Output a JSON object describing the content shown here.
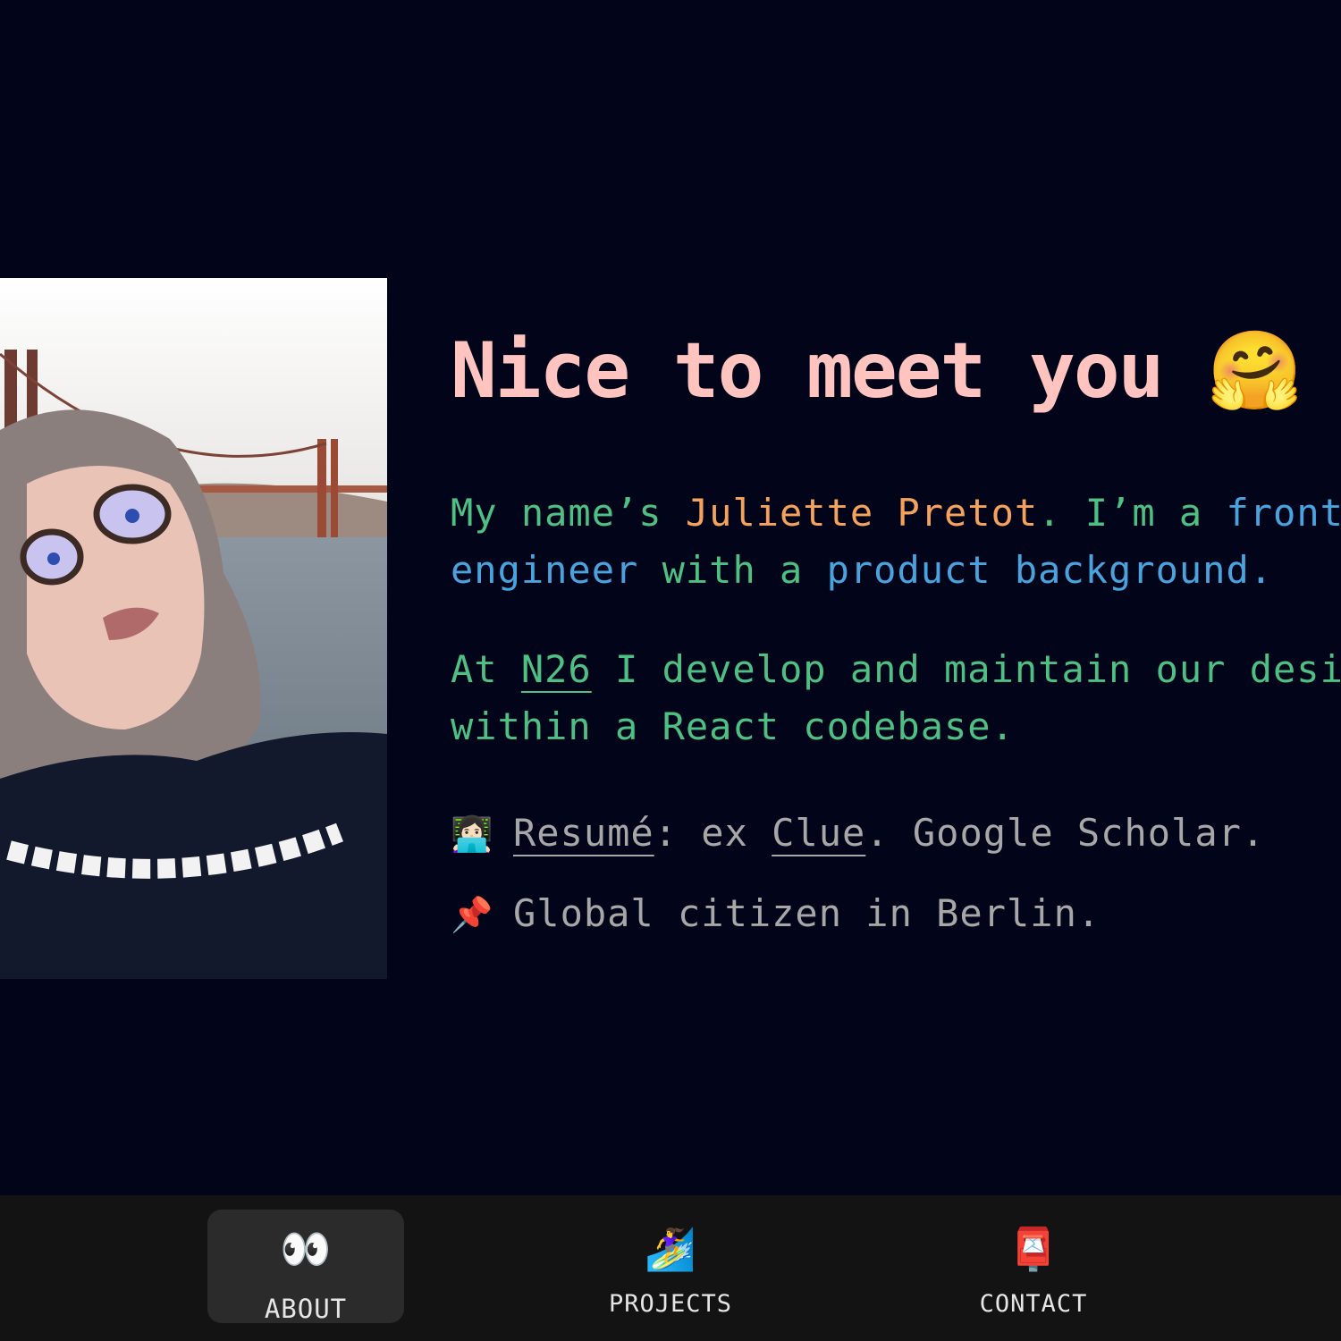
{
  "hero": {
    "title": "Nice to meet you",
    "title_emoji": "🤗"
  },
  "intro": {
    "part1": "My name’s ",
    "name": "Juliette Pretot",
    "part2": ". I’m a ",
    "role1": "frontend",
    "role2": "engineer",
    "part3": " with a ",
    "role3": "product background",
    "part4": "."
  },
  "work": {
    "part1": "At ",
    "company": "N26",
    "part2": " I develop and maintain our design system",
    "part3": "within a React codebase."
  },
  "links": {
    "emoji": "👩🏻‍💻",
    "resume": "Resumé",
    "part1": ": ex ",
    "clue": "Clue",
    "part2": ". Google Scholar."
  },
  "location": {
    "emoji": "📌",
    "text": "Global citizen in Berlin."
  },
  "nav": {
    "items": [
      {
        "icon": "👀",
        "label": "ABOUT"
      },
      {
        "icon": "🏄‍♀️",
        "label": "PROJECTS"
      },
      {
        "icon": "📮",
        "label": "CONTACT"
      }
    ]
  },
  "colors": {
    "background": "#02041a",
    "title": "#ffc4c0",
    "green": "#4fc083",
    "orange": "#f5a35c",
    "blue": "#4aa3dd",
    "gray": "#a7a7a7",
    "nav_bg": "#131313"
  }
}
